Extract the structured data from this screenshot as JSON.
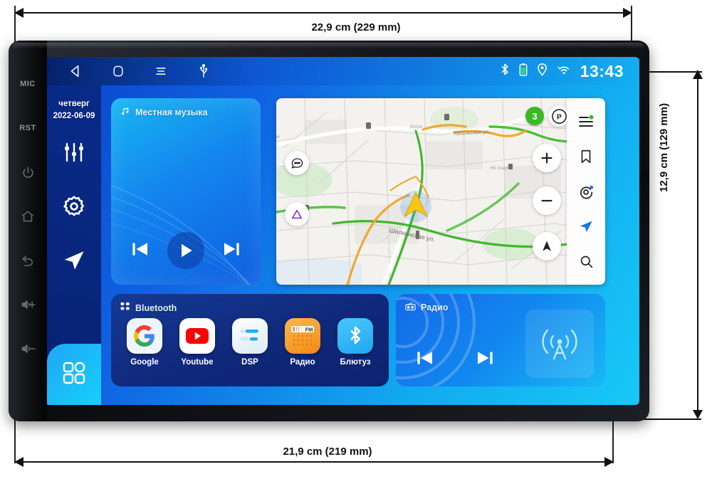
{
  "dimensions": {
    "top": "22,9 cm (229 mm)",
    "bottom": "21,9 cm (219 mm)",
    "right": "12,9 cm (129 mm)"
  },
  "bezel": {
    "labels": [
      "MIC",
      "RST"
    ],
    "buttons": [
      {
        "name": "power-icon",
        "label": "power"
      },
      {
        "name": "home-icon",
        "label": "home"
      },
      {
        "name": "back-icon",
        "label": "back"
      },
      {
        "name": "volume-up-icon",
        "label": "volume up"
      },
      {
        "name": "volume-down-icon",
        "label": "volume down"
      }
    ]
  },
  "statusbar": {
    "nav": [
      {
        "name": "back-triangle-icon",
        "label": "back"
      },
      {
        "name": "home-square-icon",
        "label": "home"
      },
      {
        "name": "menu-lines-icon",
        "label": "menu"
      },
      {
        "name": "usb-icon",
        "label": "usb"
      }
    ],
    "indicators": [
      {
        "name": "bluetooth-icon",
        "label": "bluetooth"
      },
      {
        "name": "battery-icon",
        "label": "battery"
      },
      {
        "name": "location-pin-icon",
        "label": "location"
      },
      {
        "name": "wifi-icon",
        "label": "wifi"
      }
    ],
    "clock": "13:43"
  },
  "sidebar": {
    "day": "четверг",
    "date": "2022-06-09",
    "items": [
      {
        "name": "equalizer-icon",
        "label": "equalizer"
      },
      {
        "name": "gear-icon",
        "label": "settings"
      },
      {
        "name": "navigation-arrow-icon",
        "label": "navigation"
      },
      {
        "name": "apps-grid-icon",
        "label": "apps"
      }
    ]
  },
  "music": {
    "title": "Местная музыка",
    "icon": "music-note-icon",
    "controls": [
      {
        "name": "previous-track-button",
        "label": "previous"
      },
      {
        "name": "play-button",
        "label": "play"
      },
      {
        "name": "next-track-button",
        "label": "next"
      }
    ]
  },
  "map": {
    "streets": [
      "Тобольская ул.",
      "Шилкинская ул."
    ],
    "poi_labels": [
      "Терми",
      "Остро",
      "НК Усеут",
      "НК",
      "То"
    ],
    "traffic_badge": "3",
    "buttons": [
      {
        "name": "parking-button",
        "label": "P"
      },
      {
        "name": "chat-bubble-button",
        "label": "chat"
      },
      {
        "name": "layers-triangle-button",
        "label": "layers"
      },
      {
        "name": "zoom-in-button",
        "label": "+"
      },
      {
        "name": "zoom-out-button",
        "label": "−"
      },
      {
        "name": "recenter-button",
        "label": "recenter"
      }
    ],
    "rail": [
      {
        "name": "menu-badge-icon",
        "label": "menu"
      },
      {
        "name": "bookmark-icon",
        "label": "bookmarks"
      },
      {
        "name": "disc-icon",
        "label": "music"
      },
      {
        "name": "navigation-arrow-icon",
        "label": "navigate"
      },
      {
        "name": "search-icon",
        "label": "search"
      }
    ],
    "colors": {
      "traffic_green": "#3cb827",
      "traffic_orange": "#f0a830",
      "vehicle": "#f5c518",
      "accent_blue": "#1a73e8"
    }
  },
  "apps_panel": {
    "title": "Bluetooth",
    "icon": "apps-dots-icon",
    "apps": [
      {
        "name": "app-google",
        "label": "Google"
      },
      {
        "name": "app-youtube",
        "label": "Youtube"
      },
      {
        "name": "app-dsp",
        "label": "DSP"
      },
      {
        "name": "app-radio",
        "label": "Радио",
        "badge": "FM"
      },
      {
        "name": "app-bluetooth",
        "label": "Блютуз"
      }
    ]
  },
  "radio": {
    "title": "Радио",
    "icon": "radio-icon",
    "controls": [
      {
        "name": "radio-previous-button",
        "label": "previous"
      },
      {
        "name": "radio-next-button",
        "label": "next"
      }
    ],
    "art_icon": "radio-tower-icon"
  }
}
